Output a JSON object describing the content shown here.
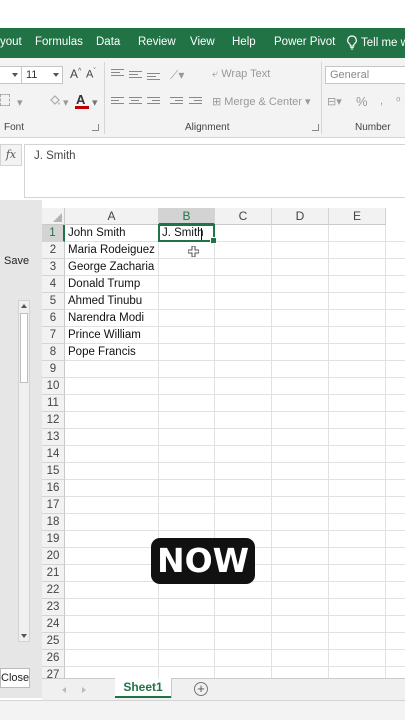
{
  "ribbon": {
    "tabs": [
      "yout",
      "Formulas",
      "Data",
      "Review",
      "View",
      "Help",
      "Power Pivot",
      "Tell me w"
    ],
    "font_size": "11",
    "wrap_text": "Wrap Text",
    "merge_center": "Merge & Center",
    "number_format": "General",
    "percent_symbol": "%",
    "groups": {
      "font": "Font",
      "alignment": "Alignment",
      "number": "Number"
    },
    "font_color": "#c00000",
    "accent": "#217346"
  },
  "formula_bar": {
    "fx": "fx",
    "value": "J. Smith"
  },
  "left_panel": {
    "save": "Save",
    "close": "Close"
  },
  "columns": [
    "A",
    "B",
    "C",
    "D",
    "E"
  ],
  "rows": [
    "1",
    "2",
    "3",
    "4",
    "5",
    "6",
    "7",
    "8",
    "9",
    "10",
    "11",
    "12",
    "13",
    "14",
    "15",
    "16",
    "17",
    "18",
    "19",
    "20",
    "21",
    "22",
    "23",
    "24",
    "25",
    "26",
    "27"
  ],
  "cells": {
    "A": [
      "John Smith",
      "Maria Rodeiguez",
      "George Zacharia",
      "Donald Trump",
      "Ahmed Tinubu",
      "Narendra Modi",
      "Prince William",
      "Pope Francis"
    ],
    "B1": "J. Smith"
  },
  "overlay_text": "NOW",
  "sheets": {
    "active": "Sheet1",
    "add": "+"
  }
}
